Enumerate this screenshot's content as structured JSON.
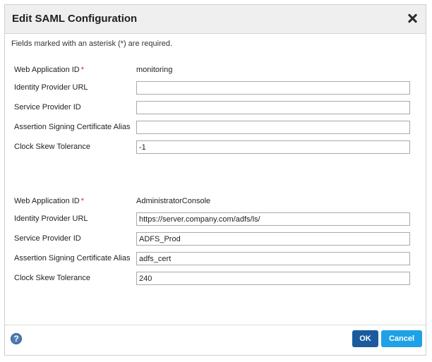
{
  "dialog": {
    "title": "Edit SAML Configuration",
    "required_note": "Fields marked with an asterisk (*) are required.",
    "asterisk": "*"
  },
  "labels": {
    "web_app_id": "Web Application ID",
    "idp_url": "Identity Provider URL",
    "sp_id": "Service Provider ID",
    "cert_alias": "Assertion Signing Certificate Alias",
    "clock_skew": "Clock Skew Tolerance"
  },
  "configs": [
    {
      "web_app_id": "monitoring",
      "idp_url": "",
      "sp_id": "",
      "cert_alias": "",
      "clock_skew": "-1"
    },
    {
      "web_app_id": "AdministratorConsole",
      "idp_url": "https://server.company.com/adfs/ls/",
      "sp_id": "ADFS_Prod",
      "cert_alias": "adfs_cert",
      "clock_skew": "240"
    }
  ],
  "footer": {
    "help_glyph": "?",
    "ok_label": "OK",
    "cancel_label": "Cancel"
  },
  "colors": {
    "primary_button": "#1c5a9e",
    "secondary_button": "#1fa1e6",
    "required_asterisk": "#d9262b",
    "help_icon": "#4d7cb2"
  }
}
